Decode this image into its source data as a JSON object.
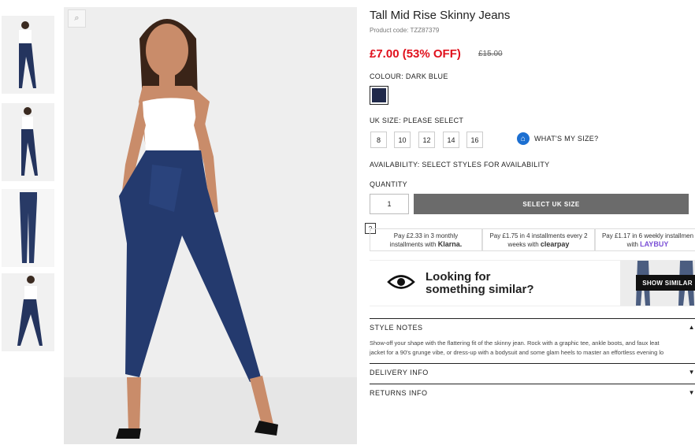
{
  "product": {
    "title": "Tall Mid Rise Skinny Jeans",
    "code": "Product code: TZZ87379",
    "price": "£7.00 (53% OFF)",
    "was_price": "£15.00"
  },
  "colour": {
    "label": "COLOUR:",
    "value": "DARK BLUE",
    "swatch_color": "#20294a"
  },
  "size": {
    "label": "UK SIZE:",
    "value": "PLEASE SELECT",
    "options": [
      "8",
      "10",
      "12",
      "14",
      "16"
    ],
    "guide": "WHAT'S MY SIZE?"
  },
  "availability": {
    "label": "AVAILABILITY:",
    "value": "SELECT STYLES FOR AVAILABILITY"
  },
  "quantity": {
    "label": "QUANTITY",
    "value": "1"
  },
  "cta": {
    "label": "SELECT UK SIZE"
  },
  "payments": [
    {
      "line1": "Pay £2.33 in 3 monthly",
      "line2": "installments with",
      "brand": "Klarna."
    },
    {
      "line1": "Pay £1.75 in 4 installments every 2",
      "line2": "weeks with",
      "brand": "clearpay"
    },
    {
      "line1": "Pay £1.17 in 6 weekly installmen",
      "line2": "with",
      "brand": "LAYBUY"
    }
  ],
  "payment_help": "?",
  "similar": {
    "line1": "Looking for",
    "line2": "something similar?",
    "button": "SHOW SIMILAR"
  },
  "accordion": {
    "style_notes": "STYLE NOTES",
    "style_text_1": "Show-off your shape with the flattering fit of the skinny jean. Rock with a graphic tee, ankle boots, and faux leat",
    "style_text_2": "jacket for a 90's grunge vibe, or dress-up with a bodysuit and some glam heels to master an effortless evening lo",
    "delivery": "DELIVERY INFO",
    "returns": "RETURNS INFO"
  },
  "icons": {
    "zoom": "zoom-icon",
    "hanger": "hanger-icon",
    "eye": "eye-icon"
  }
}
